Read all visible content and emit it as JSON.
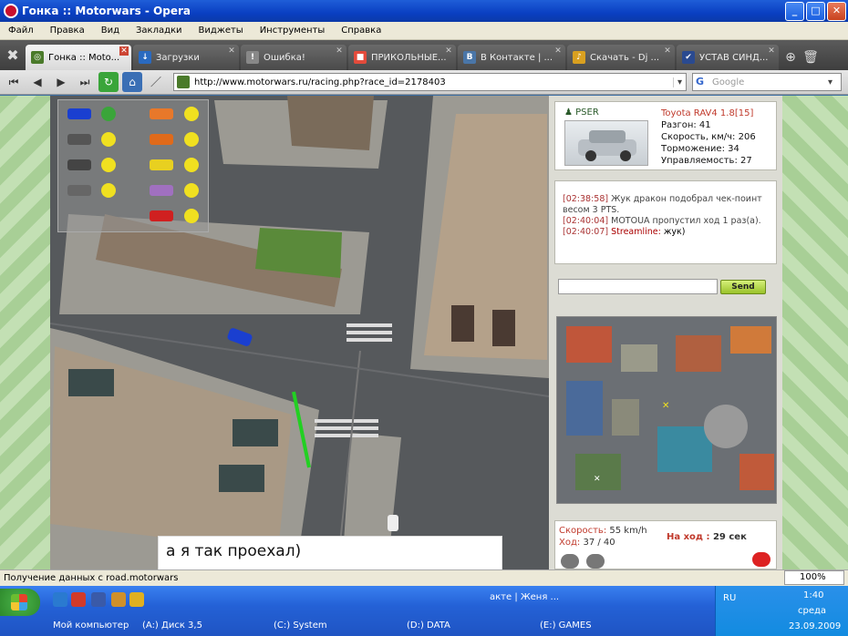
{
  "window": {
    "title": "Гонка :: Motorwars - Opera"
  },
  "menu": [
    "Файл",
    "Правка",
    "Вид",
    "Закладки",
    "Виджеты",
    "Инструменты",
    "Справка"
  ],
  "tabs": [
    {
      "label": "Гонка :: Moto...",
      "favicon_color": "#4a7a2a",
      "active": true
    },
    {
      "label": "Загрузки",
      "favicon_color": "#2a6ac0",
      "active": false
    },
    {
      "label": "Ошибка!",
      "favicon_color": "#888888",
      "active": false
    },
    {
      "label": "ПРИКОЛЬНЫЕ...",
      "favicon_color": "#e34b3b",
      "active": false
    },
    {
      "label": "В Контакте | ...",
      "favicon_color": "#4a76a8",
      "active": false
    },
    {
      "label": "Скачать - Dj ...",
      "favicon_color": "#d9a020",
      "active": false
    },
    {
      "label": "УСТАВ СИНД...",
      "favicon_color": "#2a4a90",
      "active": false
    }
  ],
  "address": {
    "url": "http://www.motorwars.ru/racing.php?race_id=2178403",
    "search_placeholder": "Google"
  },
  "car": {
    "player": "PSER",
    "name": "Toyota RAV4 1.8[15]",
    "accel": "Разгон: 41",
    "speed": "Скорость, км/ч: 206",
    "brake": "Торможение: 34",
    "handling": "Управляемость: 27"
  },
  "chat": {
    "messages": [
      {
        "time": "[02:38:58]",
        "text": "Жук дракон подобрал чек-поинт весом 3 PTS."
      },
      {
        "time": "[02:40:04]",
        "text": "MOTOUA пропустил ход 1 раз(а)."
      },
      {
        "time": "[02:40:07]",
        "nick": "Streamline:",
        "text": "жук)"
      }
    ],
    "send_label": "Send"
  },
  "status": {
    "speed_label": "Скорость:",
    "speed_value": "55 km/h",
    "move_label": "Ход:",
    "move_value": "37 / 40",
    "turn_label": "На ход :",
    "turn_value": "29 сек"
  },
  "note": "а я так проехал)",
  "statusbar": {
    "text": "Получение данных с road.motorwars",
    "zoom": "100%"
  },
  "taskbar": {
    "task": "акте | Женя ...",
    "lang": "RU",
    "time": "1:40",
    "day": "среда",
    "date": "23.09.2009",
    "drives": [
      "Мой компьютер",
      "(A:) Диск 3,5",
      "(C:) System",
      "(D:) DATA",
      "(E:) GAMES"
    ]
  },
  "colors": {
    "title_bar": "#0a3fc2",
    "accent_red": "#c0392b",
    "send_green": "#9ac22a",
    "route_green": "#22d022"
  }
}
